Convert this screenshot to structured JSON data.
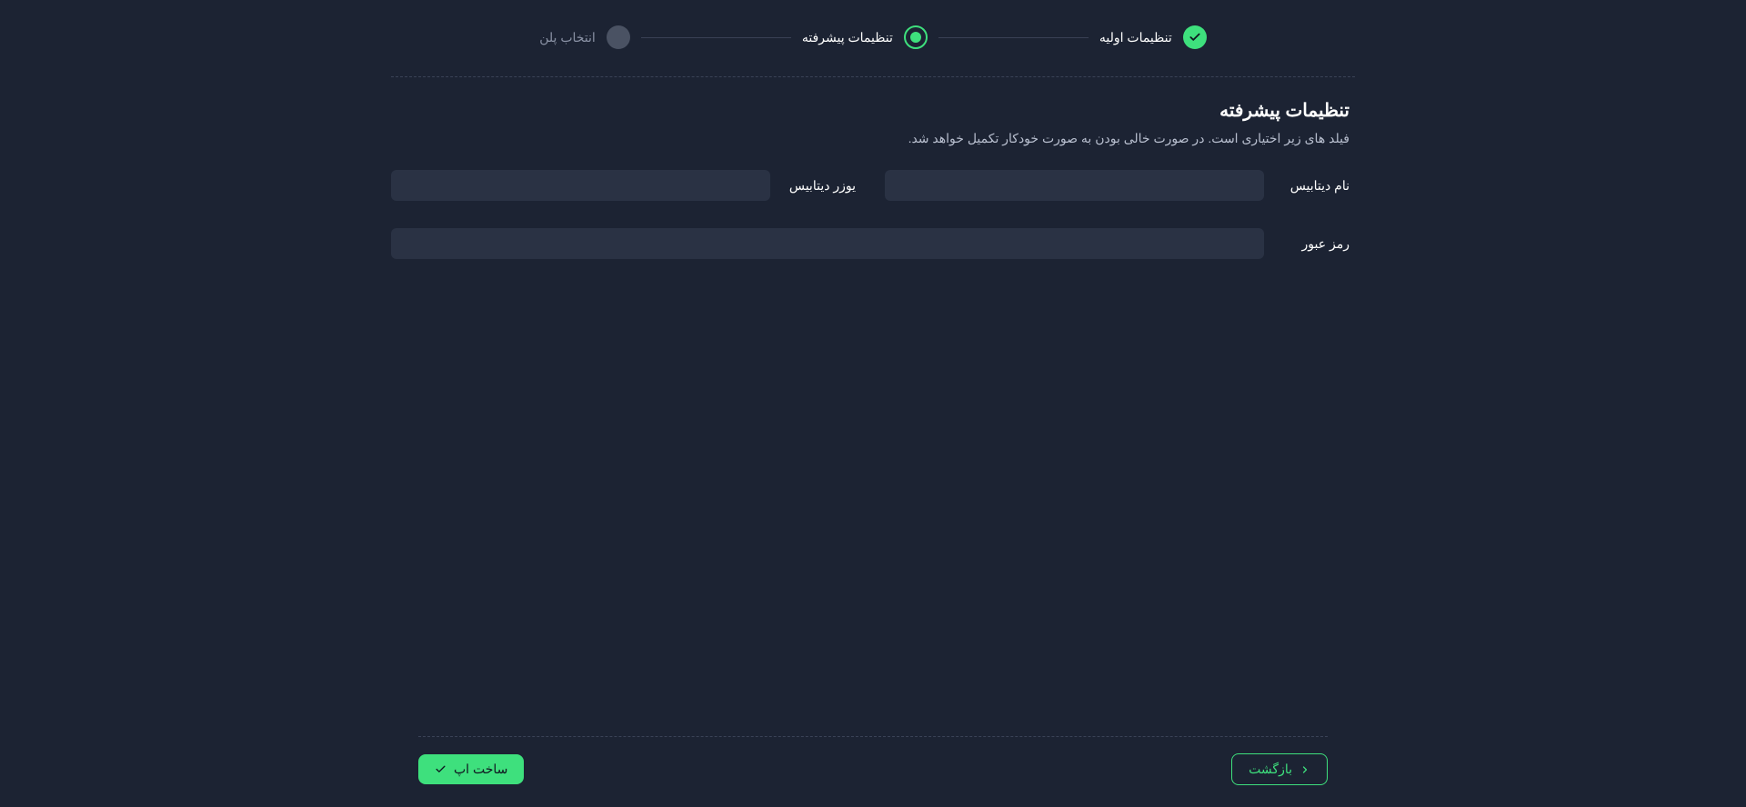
{
  "stepper": {
    "steps": [
      {
        "label": "تنظیمات اولیه",
        "state": "done"
      },
      {
        "label": "تنظیمات پیشرفته",
        "state": "active"
      },
      {
        "label": "انتخاب پلن",
        "state": "pending"
      }
    ]
  },
  "content": {
    "title": "تنظیمات پیشرفته",
    "subtitle": "فیلد های زیر اختیاری است. در صورت خالی بودن به صورت خودکار تکمیل خواهد شد."
  },
  "form": {
    "db_name_label": "نام دیتابیس",
    "db_name_value": "",
    "db_user_label": "یوزر دیتابیس",
    "db_user_value": "",
    "password_label": "رمز عبور",
    "password_value": ""
  },
  "footer": {
    "back_label": "بازگشت",
    "submit_label": "ساخت اپ"
  }
}
